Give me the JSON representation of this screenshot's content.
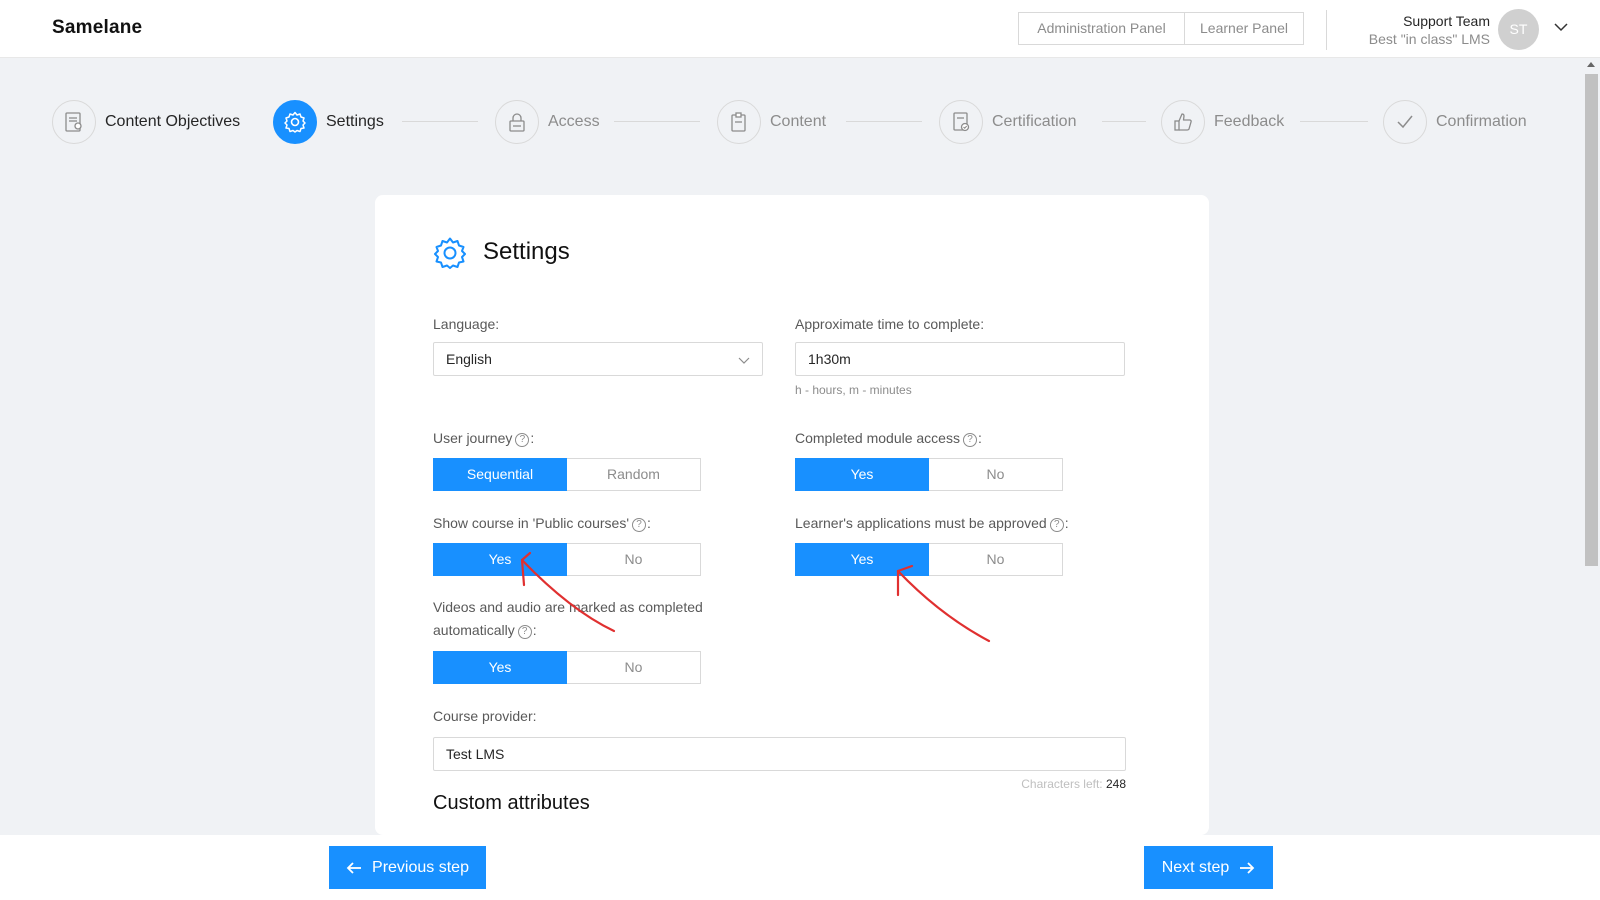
{
  "header": {
    "logo": "Samelane",
    "admin_panel": "Administration Panel",
    "learner_panel": "Learner Panel",
    "user_name": "Support Team",
    "user_subtitle": "Best \"in class\" LMS",
    "avatar_initials": "ST"
  },
  "steps": [
    {
      "label": "Content Objectives",
      "icon": "document-icon",
      "state": "done"
    },
    {
      "label": "Settings",
      "icon": "gear-icon",
      "state": "active"
    },
    {
      "label": "Access",
      "icon": "lock-icon",
      "state": "pending"
    },
    {
      "label": "Content",
      "icon": "clipboard-icon",
      "state": "pending"
    },
    {
      "label": "Certification",
      "icon": "certificate-icon",
      "state": "pending"
    },
    {
      "label": "Feedback",
      "icon": "thumbs-up-icon",
      "state": "pending"
    },
    {
      "label": "Confirmation",
      "icon": "check-icon",
      "state": "pending"
    }
  ],
  "card": {
    "title": "Settings",
    "language": {
      "label": "Language",
      "value": "English"
    },
    "approx_time": {
      "label": "Approximate time to complete",
      "value": "1h30m",
      "hint": "h - hours, m - minutes"
    },
    "user_journey": {
      "label": "User journey",
      "options": [
        "Sequential",
        "Random"
      ],
      "selected": "Sequential"
    },
    "completed_module_access": {
      "label": "Completed module access",
      "options": [
        "Yes",
        "No"
      ],
      "selected": "Yes"
    },
    "show_public": {
      "label": "Show course in 'Public courses'",
      "options": [
        "Yes",
        "No"
      ],
      "selected": "Yes"
    },
    "learner_approval": {
      "label": "Learner's applications must be approved",
      "options": [
        "Yes",
        "No"
      ],
      "selected": "Yes"
    },
    "videos_auto": {
      "label_line1": "Videos and audio are marked as completed",
      "label_line2": "automatically",
      "options": [
        "Yes",
        "No"
      ],
      "selected": "Yes"
    },
    "course_provider": {
      "label": "Course provider",
      "value": "Test LMS",
      "chars_left_label": "Characters left:",
      "chars_left": "248"
    },
    "custom_attributes_title": "Custom attributes"
  },
  "footer": {
    "prev_label": "Previous step",
    "next_label": "Next step"
  },
  "colors": {
    "accent": "#1890ff",
    "annotation": "#e03030"
  }
}
